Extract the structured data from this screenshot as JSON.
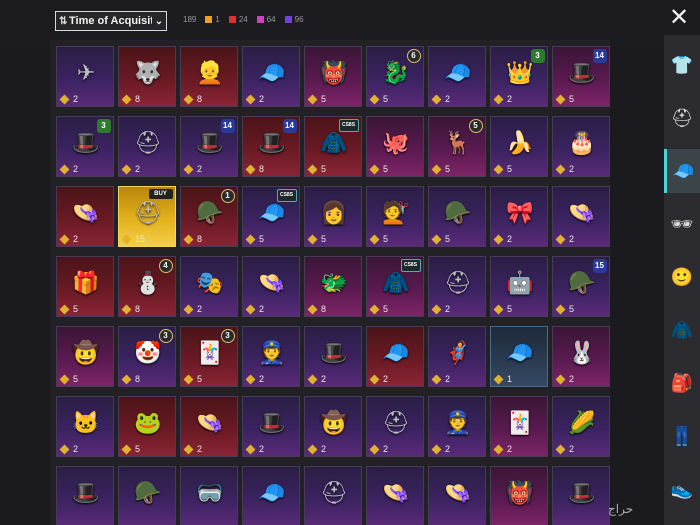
{
  "toolbar": {
    "sort_label": "Time of Acquisitior",
    "sort_icon": "sort-icon",
    "total": "189",
    "counts": [
      {
        "value": "1",
        "color": "#f0a020"
      },
      {
        "value": "24",
        "color": "#e03030"
      },
      {
        "value": "64",
        "color": "#d040c0"
      },
      {
        "value": "96",
        "color": "#7040e0"
      }
    ],
    "close_icon": "close-icon",
    "close_glyph": "✕"
  },
  "items": [
    {
      "icon": "✈",
      "count": "2",
      "rarity": "purple",
      "badge": "",
      "badge_type": ""
    },
    {
      "icon": "🐺",
      "count": "8",
      "rarity": "red",
      "badge": "",
      "badge_type": ""
    },
    {
      "icon": "👱",
      "count": "8",
      "rarity": "red",
      "badge": "",
      "badge_type": ""
    },
    {
      "icon": "🧢",
      "count": "2",
      "rarity": "purple",
      "badge": "",
      "badge_type": ""
    },
    {
      "icon": "👹",
      "count": "5",
      "rarity": "pink",
      "badge": "",
      "badge_type": ""
    },
    {
      "icon": "🐉",
      "count": "5",
      "rarity": "purple",
      "badge": "6",
      "badge_type": "lvl"
    },
    {
      "icon": "🧢",
      "count": "2",
      "rarity": "purple",
      "badge": "",
      "badge_type": ""
    },
    {
      "icon": "👑",
      "count": "2",
      "rarity": "purple",
      "badge": "3",
      "badge_type": "green"
    },
    {
      "icon": "🎩",
      "count": "5",
      "rarity": "pink",
      "badge": "14",
      "badge_type": "blue"
    },
    {
      "icon": "🎩",
      "count": "2",
      "rarity": "purple",
      "badge": "3",
      "badge_type": "green"
    },
    {
      "icon": "⛑",
      "count": "2",
      "rarity": "purple",
      "badge": "",
      "badge_type": ""
    },
    {
      "icon": "🎩",
      "count": "2",
      "rarity": "purple",
      "badge": "14",
      "badge_type": "blue"
    },
    {
      "icon": "🎩",
      "count": "8",
      "rarity": "red",
      "badge": "14",
      "badge_type": "blue"
    },
    {
      "icon": "🧥",
      "count": "5",
      "rarity": "red",
      "badge": "CS8S",
      "badge_type": "cs"
    },
    {
      "icon": "🐙",
      "count": "5",
      "rarity": "pink",
      "badge": "",
      "badge_type": ""
    },
    {
      "icon": "🦌",
      "count": "5",
      "rarity": "pink",
      "badge": "5",
      "badge_type": "lvl"
    },
    {
      "icon": "🍌",
      "count": "5",
      "rarity": "purple",
      "badge": "",
      "badge_type": ""
    },
    {
      "icon": "🎂",
      "count": "2",
      "rarity": "purple",
      "badge": "",
      "badge_type": ""
    },
    {
      "icon": "👒",
      "count": "2",
      "rarity": "red",
      "badge": "",
      "badge_type": ""
    },
    {
      "icon": "⛑",
      "count": "15",
      "rarity": "gold",
      "badge": "BUY",
      "badge_type": "buy"
    },
    {
      "icon": "🪖",
      "count": "8",
      "rarity": "red",
      "badge": "1",
      "badge_type": "lvl"
    },
    {
      "icon": "🧢",
      "count": "5",
      "rarity": "purple",
      "badge": "CS8S",
      "badge_type": "cs"
    },
    {
      "icon": "👩",
      "count": "5",
      "rarity": "purple",
      "badge": "",
      "badge_type": ""
    },
    {
      "icon": "💇",
      "count": "5",
      "rarity": "purple",
      "badge": "",
      "badge_type": ""
    },
    {
      "icon": "🪖",
      "count": "5",
      "rarity": "purple",
      "badge": "",
      "badge_type": ""
    },
    {
      "icon": "🎀",
      "count": "2",
      "rarity": "purple",
      "badge": "",
      "badge_type": ""
    },
    {
      "icon": "👒",
      "count": "2",
      "rarity": "purple",
      "badge": "",
      "badge_type": ""
    },
    {
      "icon": "🎁",
      "count": "5",
      "rarity": "red",
      "badge": "",
      "badge_type": ""
    },
    {
      "icon": "⛄",
      "count": "8",
      "rarity": "red",
      "badge": "4",
      "badge_type": "lvl"
    },
    {
      "icon": "🎭",
      "count": "2",
      "rarity": "purple",
      "badge": "",
      "badge_type": ""
    },
    {
      "icon": "👒",
      "count": "2",
      "rarity": "purple",
      "badge": "",
      "badge_type": ""
    },
    {
      "icon": "🐲",
      "count": "8",
      "rarity": "pink",
      "badge": "",
      "badge_type": ""
    },
    {
      "icon": "🧥",
      "count": "5",
      "rarity": "pink",
      "badge": "CS8S",
      "badge_type": "cs"
    },
    {
      "icon": "⛑",
      "count": "2",
      "rarity": "purple",
      "badge": "",
      "badge_type": ""
    },
    {
      "icon": "🤖",
      "count": "5",
      "rarity": "purple",
      "badge": "",
      "badge_type": ""
    },
    {
      "icon": "🪖",
      "count": "5",
      "rarity": "purple",
      "badge": "15",
      "badge_type": "blue"
    },
    {
      "icon": "🤠",
      "count": "5",
      "rarity": "pink",
      "badge": "",
      "badge_type": ""
    },
    {
      "icon": "🤡",
      "count": "8",
      "rarity": "purple",
      "badge": "3",
      "badge_type": "lvl"
    },
    {
      "icon": "🃏",
      "count": "5",
      "rarity": "red",
      "badge": "3",
      "badge_type": "lvl"
    },
    {
      "icon": "👮",
      "count": "2",
      "rarity": "purple",
      "badge": "",
      "badge_type": ""
    },
    {
      "icon": "🎩",
      "count": "2",
      "rarity": "purple",
      "badge": "",
      "badge_type": ""
    },
    {
      "icon": "🧢",
      "count": "2",
      "rarity": "red",
      "badge": "",
      "badge_type": ""
    },
    {
      "icon": "🦸",
      "count": "2",
      "rarity": "purple",
      "badge": "",
      "badge_type": ""
    },
    {
      "icon": "🧢",
      "count": "1",
      "rarity": "blue",
      "badge": "",
      "badge_type": ""
    },
    {
      "icon": "🐰",
      "count": "2",
      "rarity": "pink",
      "badge": "",
      "badge_type": ""
    },
    {
      "icon": "🐱",
      "count": "2",
      "rarity": "purple",
      "badge": "",
      "badge_type": ""
    },
    {
      "icon": "🐸",
      "count": "5",
      "rarity": "red",
      "badge": "",
      "badge_type": ""
    },
    {
      "icon": "👒",
      "count": "2",
      "rarity": "red",
      "badge": "",
      "badge_type": ""
    },
    {
      "icon": "🎩",
      "count": "2",
      "rarity": "purple",
      "badge": "",
      "badge_type": ""
    },
    {
      "icon": "🤠",
      "count": "2",
      "rarity": "purple",
      "badge": "",
      "badge_type": ""
    },
    {
      "icon": "⛑",
      "count": "2",
      "rarity": "purple",
      "badge": "",
      "badge_type": ""
    },
    {
      "icon": "👮",
      "count": "2",
      "rarity": "purple",
      "badge": "",
      "badge_type": ""
    },
    {
      "icon": "🃏",
      "count": "2",
      "rarity": "pink",
      "badge": "",
      "badge_type": ""
    },
    {
      "icon": "🌽",
      "count": "2",
      "rarity": "purple",
      "badge": "",
      "badge_type": ""
    },
    {
      "icon": "🎩",
      "count": "",
      "rarity": "purple",
      "badge": "",
      "badge_type": ""
    },
    {
      "icon": "🪖",
      "count": "",
      "rarity": "purple",
      "badge": "",
      "badge_type": ""
    },
    {
      "icon": "🥽",
      "count": "",
      "rarity": "purple",
      "badge": "",
      "badge_type": ""
    },
    {
      "icon": "🧢",
      "count": "",
      "rarity": "purple",
      "badge": "",
      "badge_type": ""
    },
    {
      "icon": "⛑",
      "count": "",
      "rarity": "purple",
      "badge": "",
      "badge_type": ""
    },
    {
      "icon": "👒",
      "count": "",
      "rarity": "purple",
      "badge": "",
      "badge_type": ""
    },
    {
      "icon": "👒",
      "count": "",
      "rarity": "purple",
      "badge": "",
      "badge_type": ""
    },
    {
      "icon": "👹",
      "count": "",
      "rarity": "pink",
      "badge": "",
      "badge_type": ""
    },
    {
      "icon": "🎩",
      "count": "",
      "rarity": "purple",
      "badge": "",
      "badge_type": ""
    }
  ],
  "sidebar": {
    "tabs": [
      {
        "name": "outfit-set",
        "icon": "👕",
        "active": false
      },
      {
        "name": "helmet",
        "icon": "⛑",
        "active": false
      },
      {
        "name": "hat",
        "icon": "🧢",
        "active": true
      },
      {
        "name": "glasses",
        "icon": "🕶",
        "active": false
      },
      {
        "name": "face",
        "icon": "🙂",
        "active": false
      },
      {
        "name": "jacket",
        "icon": "🧥",
        "active": false
      },
      {
        "name": "backpack",
        "icon": "🎒",
        "active": false
      },
      {
        "name": "pants",
        "icon": "👖",
        "active": false
      },
      {
        "name": "shoes",
        "icon": "👟",
        "active": false
      }
    ]
  },
  "watermark": "حراج"
}
